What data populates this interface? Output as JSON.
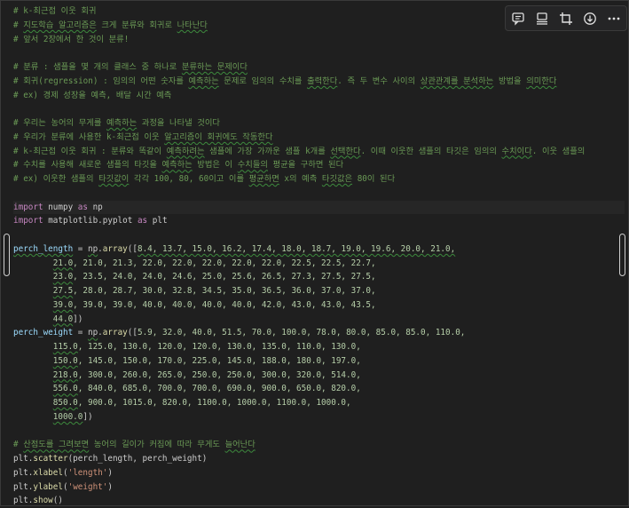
{
  "toolbar": {
    "items": [
      {
        "name": "comment-icon"
      },
      {
        "name": "split-cell-icon"
      },
      {
        "name": "crop-icon"
      },
      {
        "name": "download-icon"
      },
      {
        "name": "more-icon"
      }
    ]
  },
  "code_lines": [
    [
      {
        "t": "# k-최근접 이웃 회귀",
        "c": "cm"
      }
    ],
    [
      {
        "t": "# ",
        "c": "cm"
      },
      {
        "t": "지도학습 알고리즘은",
        "c": "cm sq"
      },
      {
        "t": " 크게 분류와 회귀로 ",
        "c": "cm"
      },
      {
        "t": "나타난다",
        "c": "cm sq"
      }
    ],
    [
      {
        "t": "# 앞서 2장에서 한 것이 분류!",
        "c": "cm"
      }
    ],
    [],
    [
      {
        "t": "# 분류 : 샘플을 몇 개의 클래스 중 하나로 ",
        "c": "cm"
      },
      {
        "t": "분류하는 문제이다",
        "c": "cm sq"
      }
    ],
    [
      {
        "t": "# 회귀(regression) : 임의의 어떤 숫자를 ",
        "c": "cm"
      },
      {
        "t": "예측하는",
        "c": "cm sq"
      },
      {
        "t": " 문제로 임의의 수치를 ",
        "c": "cm"
      },
      {
        "t": "출력한다",
        "c": "cm sq"
      },
      {
        "t": ". 즉 두 변수 사이의 ",
        "c": "cm"
      },
      {
        "t": "상관관계를 분석하는",
        "c": "cm sq"
      },
      {
        "t": " 방법을 ",
        "c": "cm"
      },
      {
        "t": "의미한다",
        "c": "cm sq"
      }
    ],
    [
      {
        "t": "# ex) 경제 성장을 예측, 배달 시간 예측",
        "c": "cm"
      }
    ],
    [],
    [
      {
        "t": "# 우리는 농어의 무게를 ",
        "c": "cm"
      },
      {
        "t": "예측하는",
        "c": "cm sq"
      },
      {
        "t": " 과정을 나타낼 것이다",
        "c": "cm"
      }
    ],
    [
      {
        "t": "# 우리가 분류에 사용한 k-최근접 이웃 ",
        "c": "cm"
      },
      {
        "t": "알고리즘이 회귀에도 작동한다",
        "c": "cm sq"
      }
    ],
    [
      {
        "t": "# k-최근접 이웃 회귀 : 분류와 똑같이 ",
        "c": "cm"
      },
      {
        "t": "예측하려는",
        "c": "cm sq"
      },
      {
        "t": " 샘플에 가장 가까운 샘플 k개를 ",
        "c": "cm"
      },
      {
        "t": "선택한다",
        "c": "cm sq"
      },
      {
        "t": ". 이때 이웃한 샘플의 타깃은 임의의 ",
        "c": "cm"
      },
      {
        "t": "수치이다",
        "c": "cm sq"
      },
      {
        "t": ". 이웃 샘플의",
        "c": "cm"
      }
    ],
    [
      {
        "t": "# 수치를 사용해 새로운 샘플의 타깃을 ",
        "c": "cm"
      },
      {
        "t": "예측하는",
        "c": "cm sq"
      },
      {
        "t": " 방법은 이 ",
        "c": "cm"
      },
      {
        "t": "수치들의",
        "c": "cm sq"
      },
      {
        "t": " 평균을 구하면 된다",
        "c": "cm"
      }
    ],
    [
      {
        "t": "# ex) 이웃한 샘플의 ",
        "c": "cm"
      },
      {
        "t": "타깃값이",
        "c": "cm sq"
      },
      {
        "t": " 각각 100, 80, 60이고 이를 ",
        "c": "cm"
      },
      {
        "t": "평균하면",
        "c": "cm sq"
      },
      {
        "t": " x의 예측 ",
        "c": "cm"
      },
      {
        "t": "타깃값은",
        "c": "cm sq"
      },
      {
        "t": " 80이 된다",
        "c": "cm"
      }
    ],
    [],
    [
      {
        "t": "import",
        "c": "kw"
      },
      {
        "t": " numpy ",
        "c": "pl"
      },
      {
        "t": "as",
        "c": "kw"
      },
      {
        "t": " np",
        "c": "pl"
      }
    ],
    [
      {
        "t": "import",
        "c": "kw"
      },
      {
        "t": " matplotlib.pyplot ",
        "c": "pl"
      },
      {
        "t": "as",
        "c": "kw"
      },
      {
        "t": " plt",
        "c": "pl"
      }
    ],
    [],
    [
      {
        "t": "perch_length",
        "c": "var sq"
      },
      {
        "t": " = ",
        "c": "pl"
      },
      {
        "t": "np",
        "c": "pl sq"
      },
      {
        "t": ".",
        "c": "pl"
      },
      {
        "t": "array",
        "c": "fn"
      },
      {
        "t": "([",
        "c": "pl"
      },
      {
        "t": "8.4, 13.7, 15.0, 16.2, 17.4, 18.0, 18.7, 19.0, 19.6, 20.0, 21.0,",
        "c": "num sq"
      }
    ],
    [
      {
        "t": "        ",
        "c": "pl"
      },
      {
        "t": "21.0",
        "c": "num sq"
      },
      {
        "t": ", 21.0, 21.3, 22.0, 22.0, 22.0, 22.0, 22.0, 22.5, 22.5, 22.7,",
        "c": "num"
      }
    ],
    [
      {
        "t": "        ",
        "c": "pl"
      },
      {
        "t": "23.0",
        "c": "num sq"
      },
      {
        "t": ", 23.5, 24.0, 24.0, 24.6, 25.0, 25.6, 26.5, 27.3, 27.5, 27.5,",
        "c": "num"
      }
    ],
    [
      {
        "t": "        ",
        "c": "pl"
      },
      {
        "t": "27.5",
        "c": "num sq"
      },
      {
        "t": ", 28.0, 28.7, 30.0, 32.8, 34.5, 35.0, 36.5, 36.0, 37.0, 37.0,",
        "c": "num"
      }
    ],
    [
      {
        "t": "        ",
        "c": "pl"
      },
      {
        "t": "39.0",
        "c": "num sq"
      },
      {
        "t": ", 39.0, 39.0, 40.0, 40.0, 40.0, 40.0, 42.0, 43.0, 43.0, 43.5,",
        "c": "num"
      }
    ],
    [
      {
        "t": "        ",
        "c": "pl"
      },
      {
        "t": "44.0",
        "c": "num sq"
      },
      {
        "t": "])",
        "c": "pl"
      }
    ],
    [
      {
        "t": "perch_weight",
        "c": "var"
      },
      {
        "t": " = ",
        "c": "pl"
      },
      {
        "t": "np",
        "c": "pl sq"
      },
      {
        "t": ".",
        "c": "pl"
      },
      {
        "t": "array",
        "c": "fn"
      },
      {
        "t": "([",
        "c": "pl"
      },
      {
        "t": "5.9, 32.0, 40.0, 51.5, 70.0, 100.0, 78.0, 80.0, 85.0, 85.0, 110.0,",
        "c": "num"
      }
    ],
    [
      {
        "t": "        ",
        "c": "pl"
      },
      {
        "t": "115.0",
        "c": "num sq"
      },
      {
        "t": ", 125.0, 130.0, 120.0, 120.0, 130.0, 135.0, 110.0, 130.0,",
        "c": "num"
      }
    ],
    [
      {
        "t": "        ",
        "c": "pl"
      },
      {
        "t": "150.0",
        "c": "num sq"
      },
      {
        "t": ", 145.0, 150.0, 170.0, 225.0, 145.0, 188.0, 180.0, 197.0,",
        "c": "num"
      }
    ],
    [
      {
        "t": "        ",
        "c": "pl"
      },
      {
        "t": "218.0",
        "c": "num sq"
      },
      {
        "t": ", 300.0, 260.0, 265.0, 250.0, 250.0, 300.0, 320.0, 514.0,",
        "c": "num"
      }
    ],
    [
      {
        "t": "        ",
        "c": "pl"
      },
      {
        "t": "556.0",
        "c": "num sq"
      },
      {
        "t": ", 840.0, 685.0, 700.0, 700.0, 690.0, 900.0, 650.0, 820.0,",
        "c": "num"
      }
    ],
    [
      {
        "t": "        ",
        "c": "pl"
      },
      {
        "t": "850.0",
        "c": "num sq"
      },
      {
        "t": ", 900.0, 1015.0, 820.0, 1100.0, 1000.0, 1100.0, 1000.0,",
        "c": "num"
      }
    ],
    [
      {
        "t": "        ",
        "c": "pl"
      },
      {
        "t": "1000.0",
        "c": "num sq"
      },
      {
        "t": "])",
        "c": "pl"
      }
    ],
    [],
    [
      {
        "t": "# ",
        "c": "cm"
      },
      {
        "t": "산점도를 그려보면",
        "c": "cm sq"
      },
      {
        "t": " 농어의 길이가 커짐에 따라 무게도 ",
        "c": "cm"
      },
      {
        "t": "늘어난다",
        "c": "cm sq"
      }
    ],
    [
      {
        "t": "plt.",
        "c": "pl"
      },
      {
        "t": "scatter",
        "c": "fn"
      },
      {
        "t": "(perch_length, perch_weight)",
        "c": "pl"
      }
    ],
    [
      {
        "t": "plt.",
        "c": "pl"
      },
      {
        "t": "xlabel",
        "c": "fn"
      },
      {
        "t": "(",
        "c": "pl"
      },
      {
        "t": "'length'",
        "c": "str"
      },
      {
        "t": ")",
        "c": "pl"
      }
    ],
    [
      {
        "t": "plt.",
        "c": "pl"
      },
      {
        "t": "ylabel",
        "c": "fn"
      },
      {
        "t": "(",
        "c": "pl"
      },
      {
        "t": "'weight'",
        "c": "str"
      },
      {
        "t": ")",
        "c": "pl"
      }
    ],
    [
      {
        "t": "plt.",
        "c": "pl"
      },
      {
        "t": "show",
        "c": "fn"
      },
      {
        "t": "()",
        "c": "pl"
      }
    ]
  ],
  "highlighted_line": 14
}
